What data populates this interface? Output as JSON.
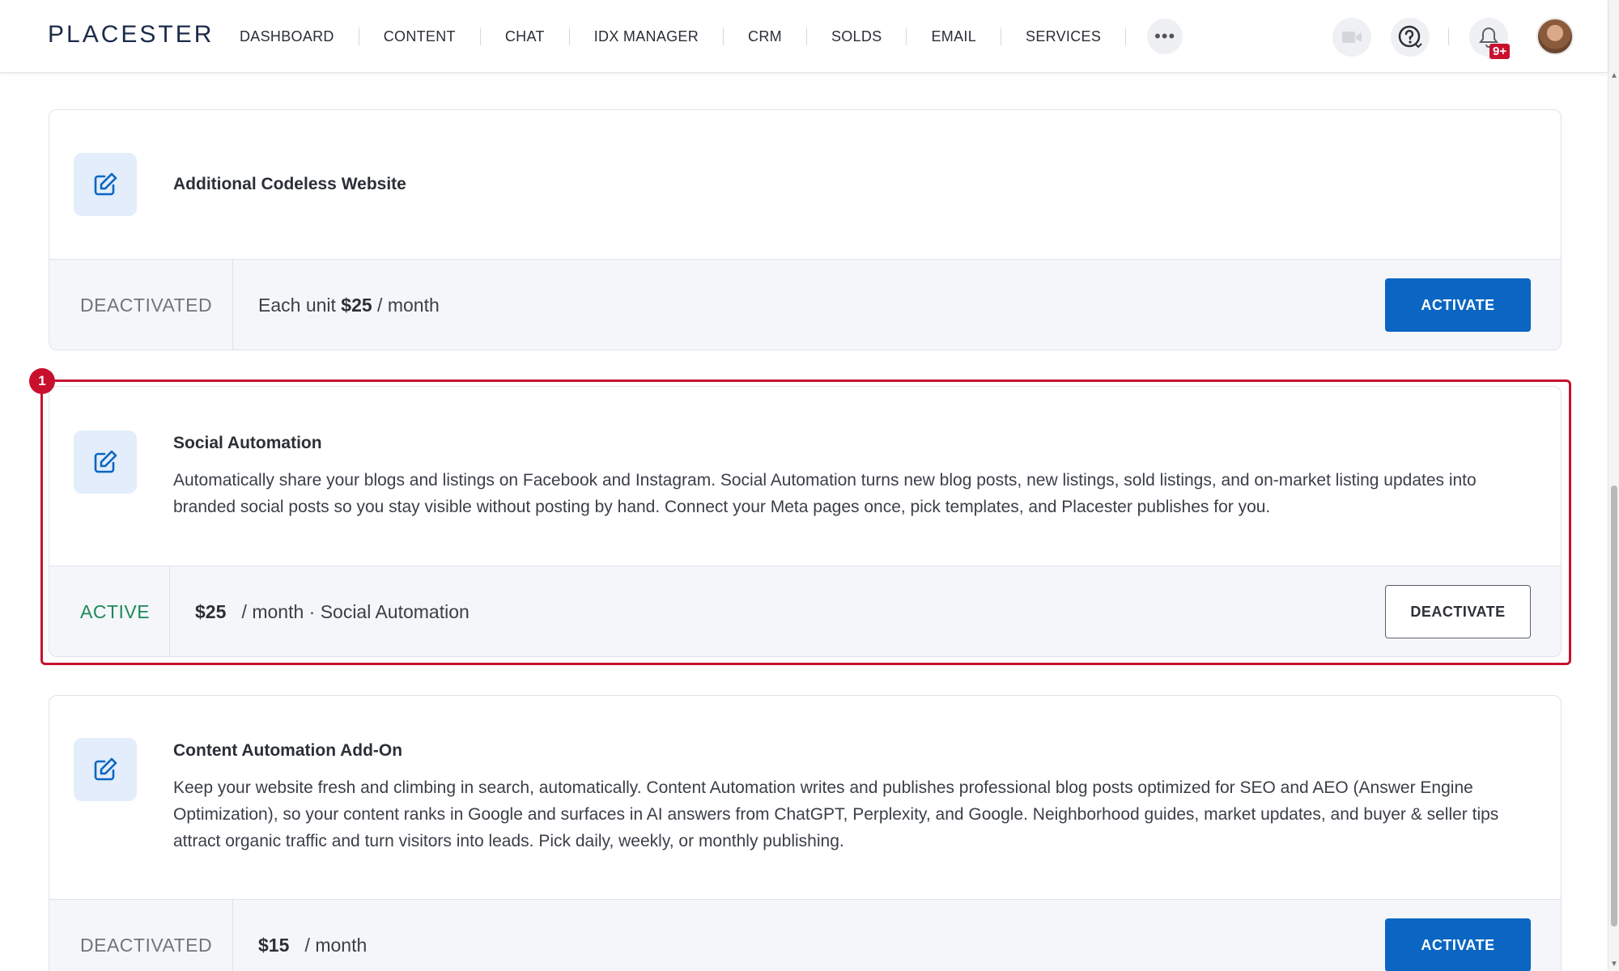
{
  "header": {
    "logo": "PLACESTER",
    "nav": [
      "DASHBOARD",
      "CONTENT",
      "CHAT",
      "IDX MANAGER",
      "CRM",
      "SOLDS",
      "EMAIL",
      "SERVICES"
    ],
    "more_label": "•••",
    "notification_badge": "9+",
    "icons": [
      "video-camera-icon",
      "help-icon",
      "bell-icon"
    ]
  },
  "highlight": {
    "number": "1",
    "color": "#c8102e"
  },
  "cards": [
    {
      "title": "Additional Codeless Website",
      "description": "",
      "status": "DEACTIVATED",
      "price_prefix": "Each unit ",
      "price_amount": "$25",
      "price_suffix": " / month",
      "button": "ACTIVATE"
    },
    {
      "title": "Social Automation",
      "description": "Automatically share your blogs and listings on Facebook and Instagram. Social Automation turns new blog posts, new listings, sold listings, and on-market listing updates into branded social posts so you stay visible without posting by hand. Connect your Meta pages once, pick templates, and Placester publishes for you.",
      "status": "ACTIVE",
      "price_prefix": "",
      "price_amount": "$25",
      "price_suffix": "   / month · Social Automation",
      "button": "DEACTIVATE"
    },
    {
      "title": "Content Automation Add-On",
      "description": "Keep your website fresh and climbing in search, automatically. Content Automation writes and publishes professional blog posts optimized for SEO and AEO (Answer Engine Optimization), so your content ranks in Google and surfaces in AI answers from ChatGPT, Perplexity, and Google. Neighborhood guides, market updates, and buyer & seller tips attract organic traffic and turn visitors into leads. Pick daily, weekly, or monthly publishing.",
      "status": "DEACTIVATED",
      "price_prefix": "",
      "price_amount": "$15",
      "price_suffix": "   / month",
      "button": "ACTIVATE"
    }
  ],
  "colors": {
    "primary": "#0a66c2",
    "active": "#1e8a57",
    "highlight": "#c8102e",
    "icon_bg": "#e3edfb"
  }
}
